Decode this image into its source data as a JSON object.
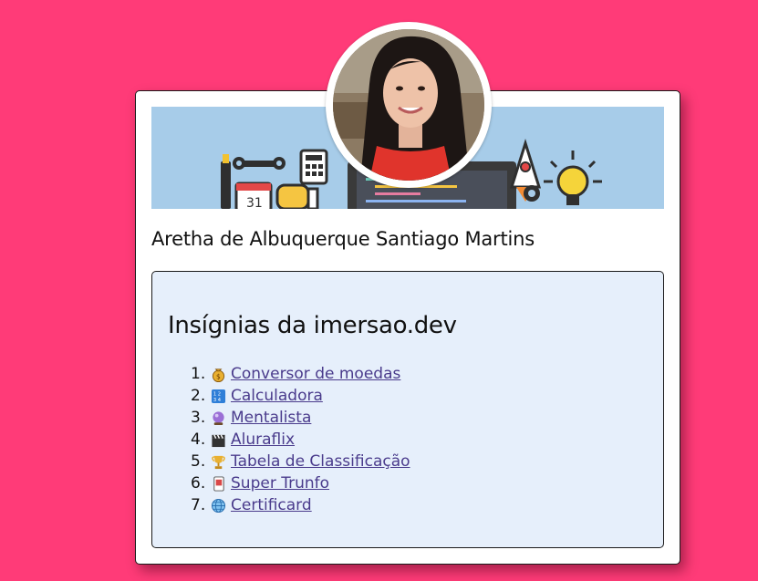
{
  "profile": {
    "name": "Aretha de Albuquerque Santiago Martins"
  },
  "badges": {
    "title": "Insígnias da imersao.dev",
    "items": [
      {
        "number": "1.",
        "icon": "money-bag-icon",
        "label": "Conversor de moedas"
      },
      {
        "number": "2.",
        "icon": "numbers-keypad-icon",
        "label": "Calculadora"
      },
      {
        "number": "3.",
        "icon": "crystal-ball-icon",
        "label": "Mentalista"
      },
      {
        "number": "4.",
        "icon": "clapper-board-icon",
        "label": "Aluraflix"
      },
      {
        "number": "5.",
        "icon": "trophy-icon",
        "label": "Tabela de Classificação"
      },
      {
        "number": "6.",
        "icon": "playing-card-icon",
        "label": "Super Trunfo"
      },
      {
        "number": "7.",
        "icon": "globe-icon",
        "label": "Certificard"
      }
    ]
  },
  "colors": {
    "background": "#ff3b78",
    "banner": "#a7cce9",
    "badges_panel": "#e6effb",
    "link": "#4a3b8c"
  }
}
